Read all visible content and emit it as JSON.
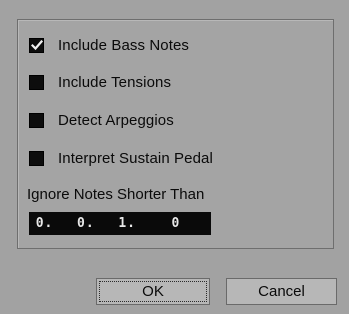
{
  "options": [
    {
      "label": "Include Bass Notes",
      "checked": true
    },
    {
      "label": "Include Tensions",
      "checked": false
    },
    {
      "label": "Detect Arpeggios",
      "checked": false
    },
    {
      "label": "Interpret Sustain Pedal",
      "checked": false
    }
  ],
  "threshold": {
    "label": "Ignore Notes Shorter Than",
    "value": "0.  0.  1.   0"
  },
  "buttons": {
    "ok_label": "OK",
    "cancel_label": "Cancel"
  }
}
